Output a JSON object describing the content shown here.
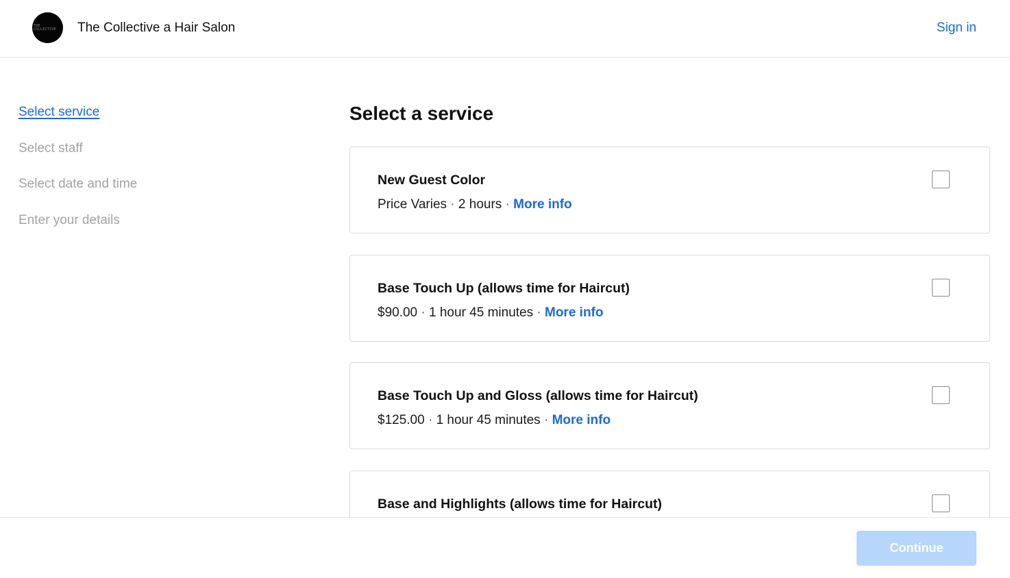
{
  "header": {
    "brand_name": "The Collective a Hair Salon",
    "logo_text_line1": "THE",
    "logo_text_line2": "COLLECTIVE",
    "sign_in_label": "Sign in"
  },
  "steps": [
    {
      "label": "Select service",
      "active": true
    },
    {
      "label": "Select staff",
      "active": false
    },
    {
      "label": "Select date and time",
      "active": false
    },
    {
      "label": "Enter your details",
      "active": false
    }
  ],
  "main": {
    "title": "Select a service",
    "more_info_label": "More info",
    "separator": "·",
    "services": [
      {
        "name": "New Guest Color",
        "price": "Price Varies",
        "duration": "2 hours",
        "selected": false
      },
      {
        "name": "Base Touch Up (allows time for Haircut)",
        "price": "$90.00",
        "duration": "1 hour 45 minutes",
        "selected": false
      },
      {
        "name": "Base Touch Up and Gloss (allows time for Haircut)",
        "price": "$125.00",
        "duration": "1 hour 45 minutes",
        "selected": false
      },
      {
        "name": "Base and Highlights (allows time for Haircut)",
        "price": "",
        "duration": "",
        "selected": false
      }
    ]
  },
  "footer": {
    "continue_label": "Continue",
    "continue_enabled": false
  },
  "colors": {
    "accent": "#1a6ad9",
    "disabled_button": "#b6d6fb",
    "muted_text": "#a3a3a3"
  }
}
